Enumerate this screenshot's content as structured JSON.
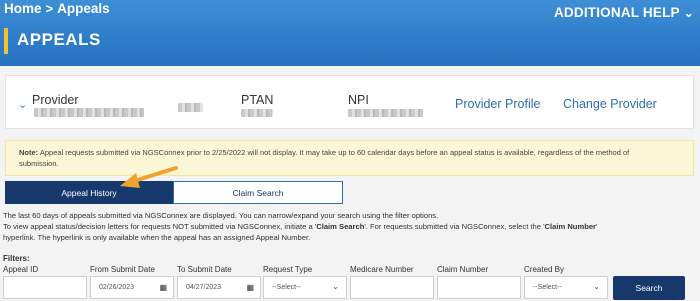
{
  "breadcrumb": {
    "home": "Home",
    "separator": ">",
    "current": "Appeals"
  },
  "header": {
    "additional_help": "ADDITIONAL HELP",
    "page_title": "APPEALS"
  },
  "provider": {
    "label": "Provider",
    "ptan_label": "PTAN",
    "npi_label": "NPI",
    "profile_link": "Provider Profile",
    "change_link": "Change Provider"
  },
  "note": {
    "lead": "Note:",
    "line1": "Appeal requests submitted via NGSConnex prior to 2/25/2022 will not display.  It may take up to 60 calendar days before an appeal status is available, regardless of the method of",
    "line2": "submission."
  },
  "tabs": {
    "history": "Appeal History",
    "claim_search": "Claim Search"
  },
  "description": {
    "line1": "The last 60 days of appeals submitted via NGSConnex are displayed.  You can narrow/expand your search using the filter options.",
    "line2_pre": "To view appeal status/decision letters for requests NOT submitted via NGSConnex, initiate a '",
    "line2_bold1": "Claim Search",
    "line2_mid": "'. For requests submitted via NGSConnex, select the '",
    "line2_bold2": "Claim Number",
    "line2_post": "'",
    "line3": "hyperlink. The hyperlink is only available when the appeal has an assigned Appeal Number."
  },
  "filters": {
    "label": "Filters:",
    "appeal_id": {
      "label": "Appeal ID",
      "value": ""
    },
    "from_date": {
      "label": "From Submit Date",
      "value": "02/26/2023"
    },
    "to_date": {
      "label": "To Submit Date",
      "value": "04/27/2023"
    },
    "request_type": {
      "label": "Request Type",
      "value": "--Select--"
    },
    "medicare_number": {
      "label": "Medicare Number",
      "value": ""
    },
    "claim_number": {
      "label": "Claim Number",
      "value": ""
    },
    "created_by": {
      "label": "Created By",
      "value": "--Select--"
    },
    "search_button": "Search"
  },
  "colors": {
    "header_blue": "#2e7ecb",
    "accent_yellow": "#f2c230",
    "navy": "#17386c",
    "arrow": "#f0a32a",
    "note_bg": "#fbf6d5"
  }
}
